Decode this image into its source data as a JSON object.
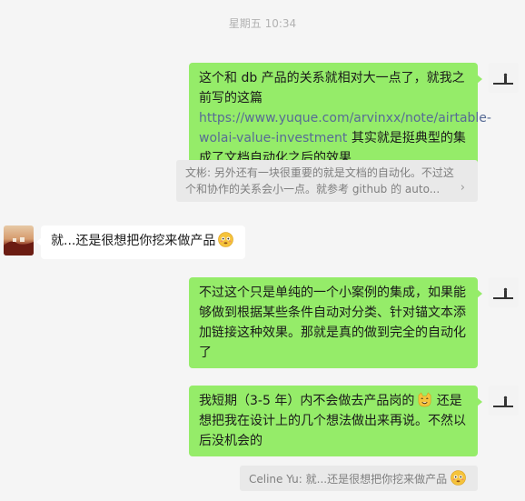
{
  "chat": {
    "timestamp": "星期五 10:34",
    "messages": [
      {
        "sender": "me",
        "text_before": "这个和 db 产品的关系就相对大一点了，就我之前写的这篇 ",
        "link_text": "https://www.yuque.com/arvinxx/note/airtable-wolai-value-investment",
        "text_after": " 其实就是挺典型的集成了文档自动化之后的效果"
      },
      {
        "sender": "quote",
        "text": "文彬: 另外还有一块很重要的就是文档的自动化。不过这个和协作的关系会小一点。就参考 github 的 auto..."
      },
      {
        "sender": "them",
        "text": "就...还是很想把你挖来做产品",
        "emoji": "flushed-face"
      },
      {
        "sender": "me",
        "text": "不过这个只是单纯的一个小案例的集成，如果能够做到根据某些条件自动对分类、针对锚文本添加链接这种效果。那就是真的做到完全的自动化了"
      },
      {
        "sender": "me",
        "text_before": "我短期（3-5 年）内不会做去产品岗的",
        "emoji": "cat-face",
        "text_after": " 还是想把我在设计上的几个想法做出来再说。不然以后没机会的"
      },
      {
        "sender": "quote",
        "text": "Celine Yu: 就...还是很想把你挖来做产品",
        "emoji": "flushed-face"
      }
    ]
  },
  "colors": {
    "background": "#f5f5f5",
    "my_bubble": "#95ec69",
    "their_bubble": "#ffffff",
    "quote_bg": "#e9e9e9",
    "link": "#576b95"
  }
}
